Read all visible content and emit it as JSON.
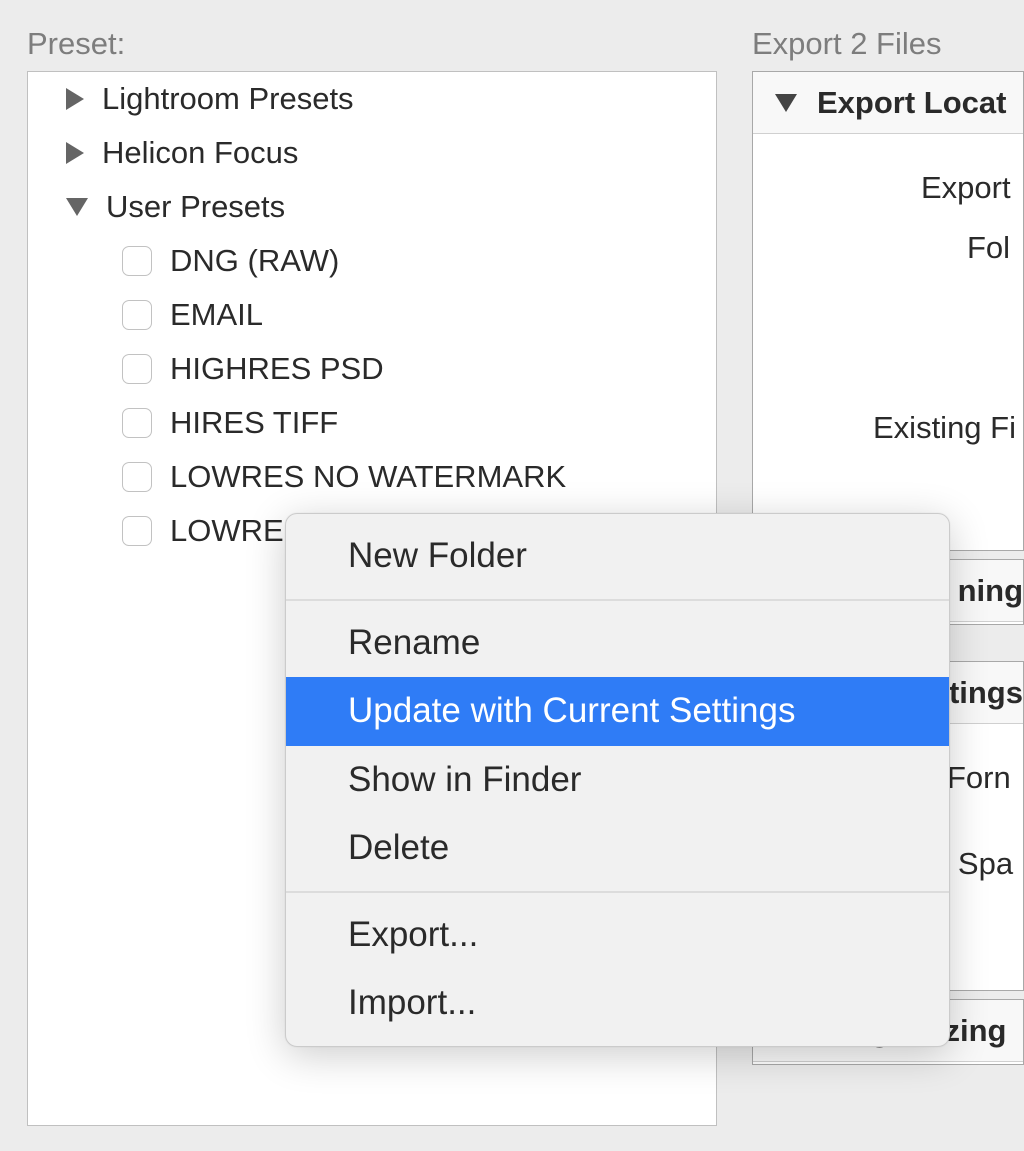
{
  "labels": {
    "preset": "Preset:",
    "export": "Export 2 Files"
  },
  "preset_tree": {
    "group_lightroom": "Lightroom Presets",
    "group_helicon": "Helicon Focus",
    "group_user": "User Presets",
    "items": [
      "DNG (RAW)",
      "EMAIL",
      "HIGHRES PSD",
      "HIRES TIFF",
      "LOWRES NO WATERMARK",
      "LOWRES"
    ]
  },
  "context_menu": {
    "new_folder": "New Folder",
    "rename": "Rename",
    "update": "Update with Current Settings",
    "show_in_finder": "Show in Finder",
    "delete": "Delete",
    "export": "Export...",
    "import": "Import..."
  },
  "right": {
    "loc_header": "Export Locat",
    "loc_export": "Export",
    "loc_folder": "Fol",
    "loc_existing": "Existing Fi",
    "naming_header": "ning",
    "settings_header": "tings",
    "settings_format": "Forn",
    "settings_space": "r Spa",
    "sizing_header": "Image Sizing"
  }
}
